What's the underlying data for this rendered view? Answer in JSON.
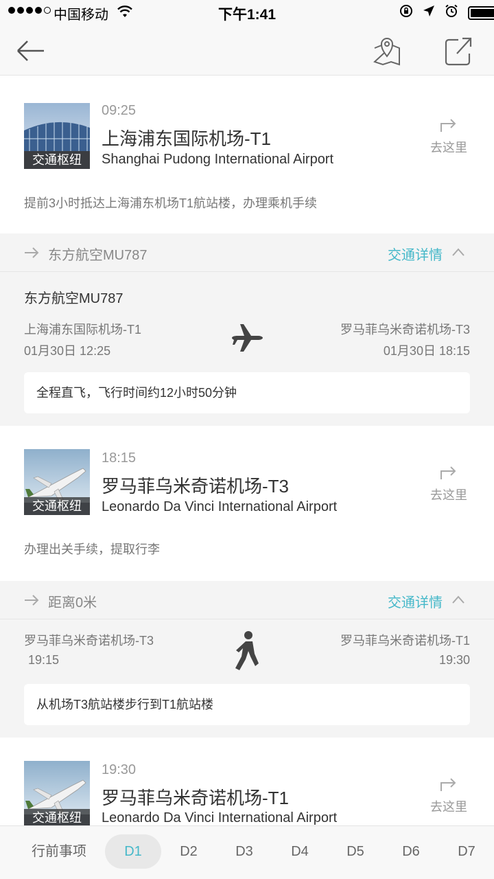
{
  "status_bar": {
    "carrier": "中国移动",
    "time": "下午1:41"
  },
  "nav": {
    "back_icon": "back-arrow-icon",
    "map_icon": "map-pin-icon",
    "share_icon": "share-icon"
  },
  "stops": [
    {
      "time": "09:25",
      "name": "上海浦东国际机场-T1",
      "name_en": "Shanghai Pudong International Airport",
      "tag": "交通枢纽",
      "goto": "去这里",
      "note": "提前3小时抵达上海浦东机场T1航站楼，办理乘机手续"
    },
    {
      "time": "18:15",
      "name": "罗马菲乌米奇诺机场-T3",
      "name_en": "Leonardo Da Vinci International Airport",
      "tag": "交通枢纽",
      "goto": "去这里",
      "note": "办理出关手续，提取行李"
    },
    {
      "time": "19:30",
      "name": "罗马菲乌米奇诺机场-T1",
      "name_en": "Leonardo Da Vinci International Airport",
      "tag": "交通枢纽",
      "goto": "去这里"
    }
  ],
  "transits": [
    {
      "title": "东方航空MU787",
      "detail_label": "交通详情",
      "flight": "东方航空MU787",
      "from": "上海浦东国际机场-T1",
      "from_time": "01月30日 12:25",
      "to": "罗马菲乌米奇诺机场-T3",
      "to_time": "01月30日 18:15",
      "note": "全程直飞，飞行时间约12小时50分钟",
      "mode_icon": "airplane-icon"
    },
    {
      "title": "距离0米",
      "detail_label": "交通详情",
      "from": "罗马菲乌米奇诺机场-T3",
      "from_time": "19:15",
      "to": "罗马菲乌米奇诺机场-T1",
      "to_time": "19:30",
      "note": "从机场T3航站楼步行到T1航站楼",
      "mode_icon": "walking-icon"
    }
  ],
  "tabs": [
    "行前事项",
    "D1",
    "D2",
    "D3",
    "D4",
    "D5",
    "D6",
    "D7"
  ],
  "active_tab": "D1",
  "colors": {
    "accent": "#45b8c9",
    "section_bg": "#f4f4f4"
  }
}
